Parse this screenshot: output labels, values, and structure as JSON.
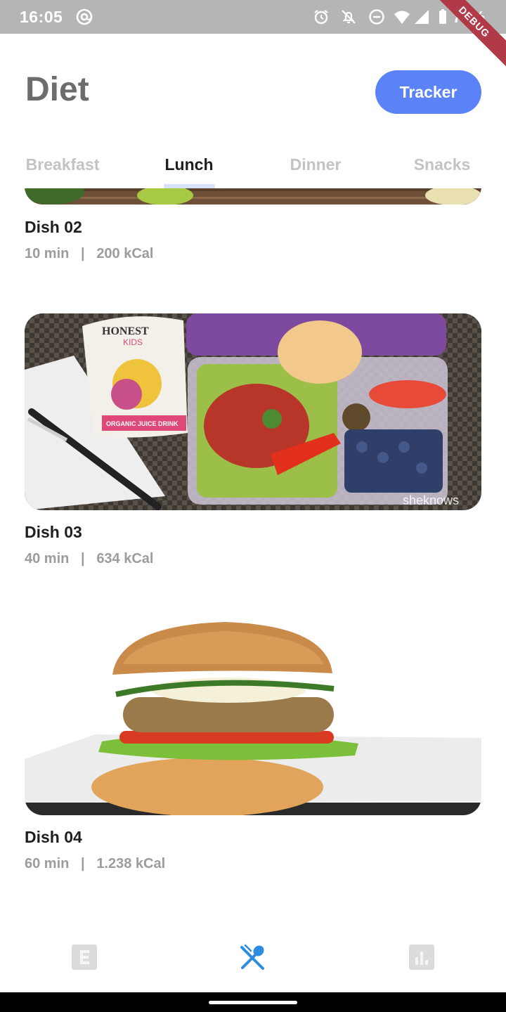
{
  "status_bar": {
    "time": "16:05",
    "battery": "73%",
    "debug_label": "DEBUG",
    "icons": [
      "at-sign-icon",
      "alarm-icon",
      "notifications-off-icon",
      "do-not-disturb-icon",
      "wifi-icon",
      "signal-icon",
      "battery-icon"
    ]
  },
  "header": {
    "title": "Diet",
    "tracker_label": "Tracker"
  },
  "tabs": [
    {
      "label": "Breakfast",
      "active": false
    },
    {
      "label": "Lunch",
      "active": true
    },
    {
      "label": "Dinner",
      "active": false
    },
    {
      "label": "Snacks",
      "active": false
    }
  ],
  "dishes": [
    {
      "name": "Dish 02",
      "time": "10 min",
      "separator": "|",
      "calories": "200 kCal"
    },
    {
      "name": "Dish 03",
      "time": "40 min",
      "separator": "|",
      "calories": "634 kCal",
      "image_watermark": "sheknows",
      "pouch_brand": "HONEST",
      "pouch_sub": "KIDS",
      "pouch_label": "ORGANIC JUICE DRINK"
    },
    {
      "name": "Dish 04",
      "time": "60 min",
      "separator": "|",
      "calories": "1.238 kCal"
    }
  ],
  "bottom_nav": {
    "items": [
      {
        "icon": "exercise-icon",
        "active": false
      },
      {
        "icon": "fork-spoon-icon",
        "active": true
      },
      {
        "icon": "bar-chart-icon",
        "active": false
      }
    ]
  },
  "colors": {
    "accent": "#5b82f6",
    "active_icon": "#2b8ce0",
    "inactive": "#c3c3c3",
    "status_bar": "#b5b5b5"
  }
}
